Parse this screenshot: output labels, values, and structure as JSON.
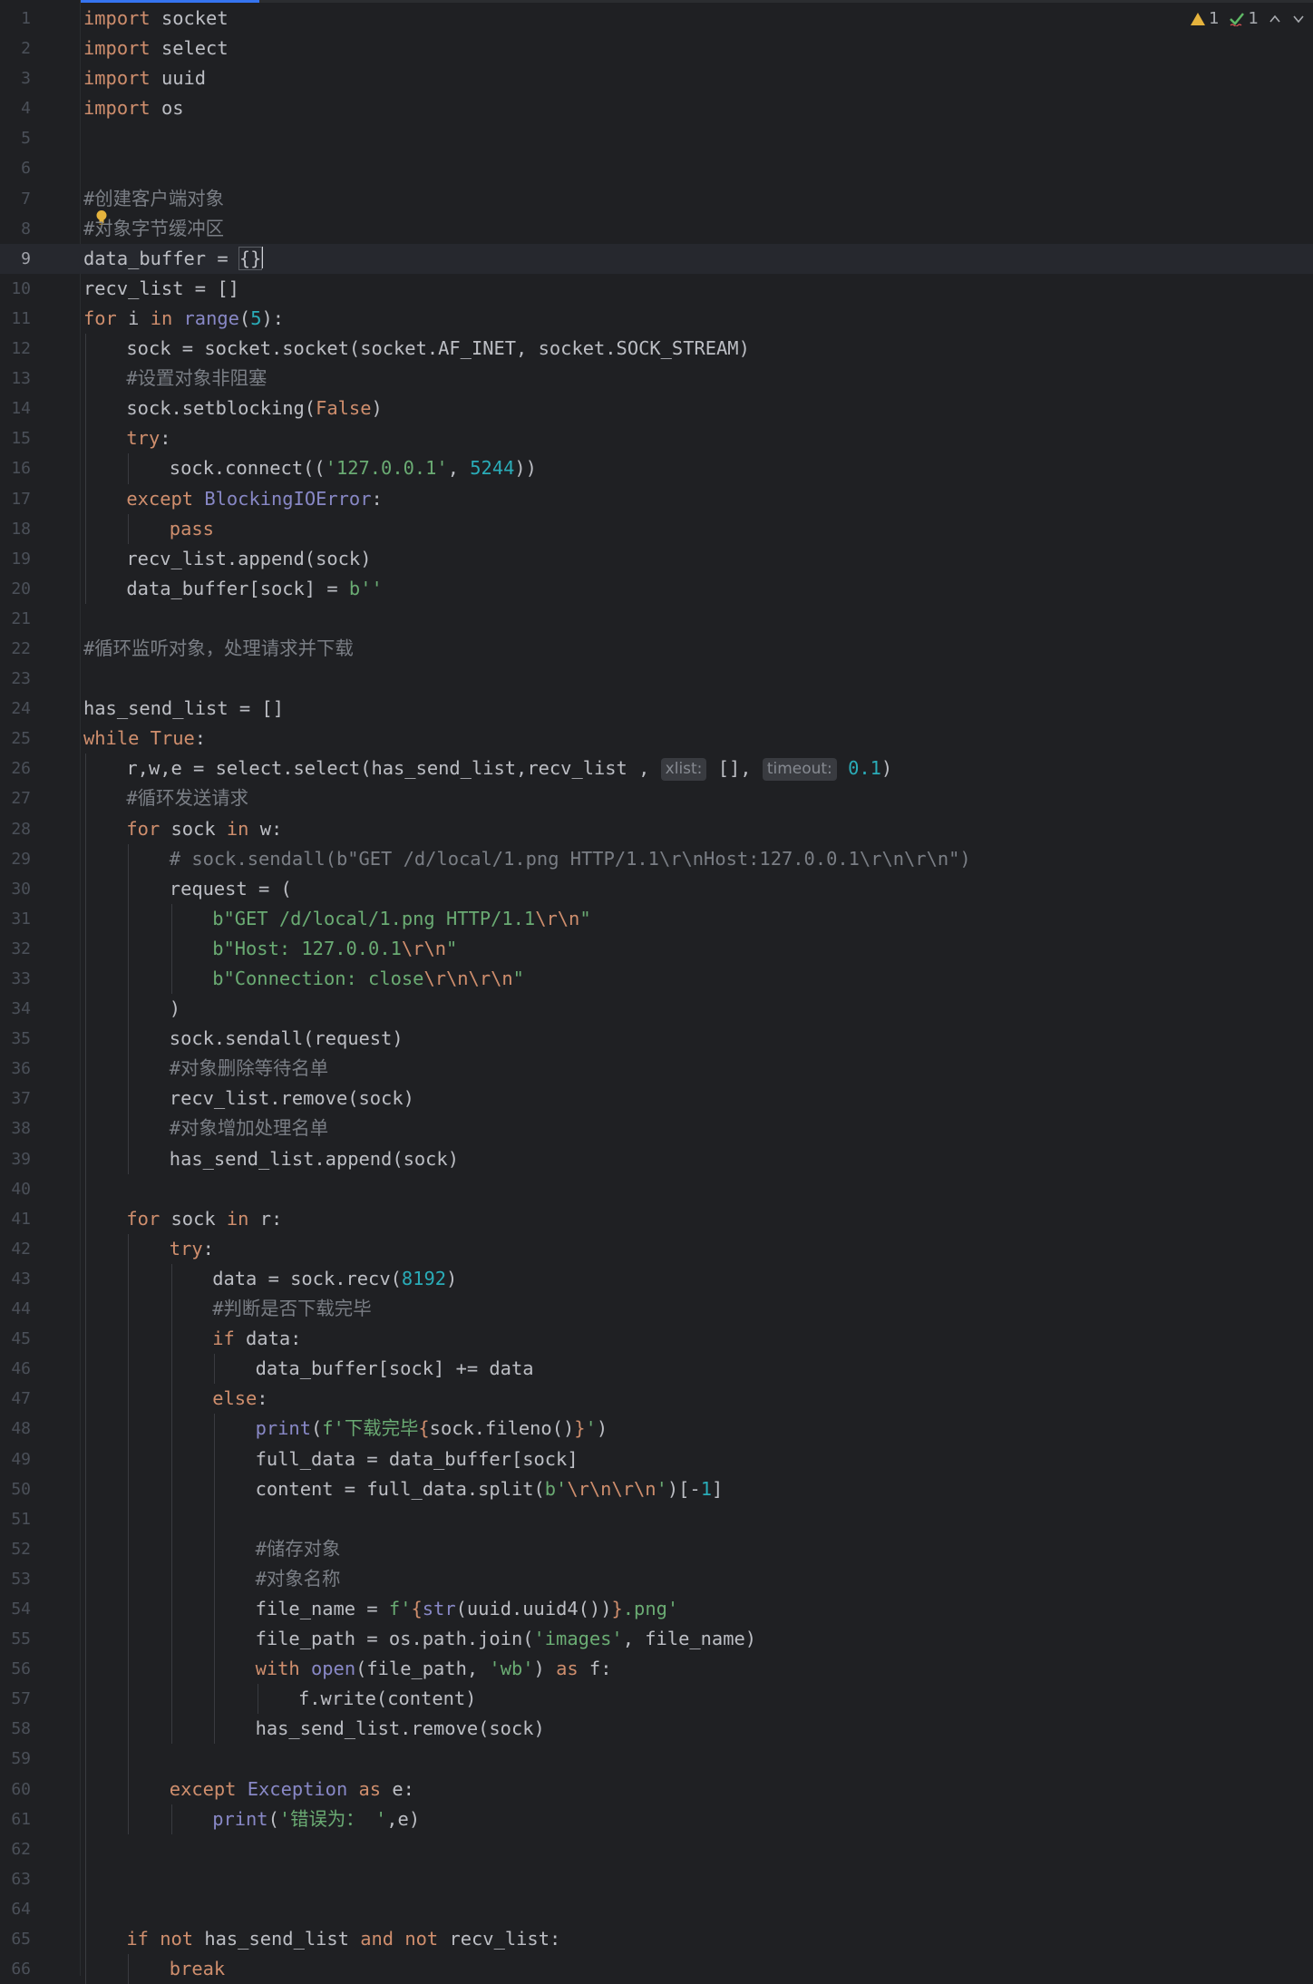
{
  "inspection": {
    "warnings_count": "1",
    "ok_count": "1",
    "up_arrow": "^",
    "down_arrow": "v"
  },
  "current_line": 9,
  "lines": [
    {
      "n": "1"
    },
    {
      "n": "2"
    },
    {
      "n": "3"
    },
    {
      "n": "4"
    },
    {
      "n": "5"
    },
    {
      "n": "6"
    },
    {
      "n": "7"
    },
    {
      "n": "8"
    },
    {
      "n": "9"
    },
    {
      "n": "10"
    },
    {
      "n": "11"
    },
    {
      "n": "12"
    },
    {
      "n": "13"
    },
    {
      "n": "14"
    },
    {
      "n": "15"
    },
    {
      "n": "16"
    },
    {
      "n": "17"
    },
    {
      "n": "18"
    },
    {
      "n": "19"
    },
    {
      "n": "20"
    },
    {
      "n": "21"
    },
    {
      "n": "22"
    },
    {
      "n": "23"
    },
    {
      "n": "24"
    },
    {
      "n": "25"
    },
    {
      "n": "26"
    },
    {
      "n": "27"
    },
    {
      "n": "28"
    },
    {
      "n": "29"
    },
    {
      "n": "30"
    },
    {
      "n": "31"
    },
    {
      "n": "32"
    },
    {
      "n": "33"
    },
    {
      "n": "34"
    },
    {
      "n": "35"
    },
    {
      "n": "36"
    },
    {
      "n": "37"
    },
    {
      "n": "38"
    },
    {
      "n": "39"
    },
    {
      "n": "40"
    },
    {
      "n": "41"
    },
    {
      "n": "42"
    },
    {
      "n": "43"
    },
    {
      "n": "44"
    },
    {
      "n": "45"
    },
    {
      "n": "46"
    },
    {
      "n": "47"
    },
    {
      "n": "48"
    },
    {
      "n": "49"
    },
    {
      "n": "50"
    },
    {
      "n": "51"
    },
    {
      "n": "52"
    },
    {
      "n": "53"
    },
    {
      "n": "54"
    },
    {
      "n": "55"
    },
    {
      "n": "56"
    },
    {
      "n": "57"
    },
    {
      "n": "58"
    },
    {
      "n": "59"
    },
    {
      "n": "60"
    },
    {
      "n": "61"
    },
    {
      "n": "62"
    },
    {
      "n": "63"
    },
    {
      "n": "64"
    },
    {
      "n": "65"
    },
    {
      "n": "66"
    }
  ],
  "code": {
    "l1": [
      "import",
      " socket"
    ],
    "l2": [
      "import",
      " select"
    ],
    "l3": [
      "import",
      " uuid"
    ],
    "l4": [
      "import",
      " os"
    ],
    "l7": "#创建客户端对象",
    "l8": "#对象字节缓冲区",
    "l9": [
      "data_buffer = ",
      "{}"
    ],
    "l10": "recv_list = []",
    "l11": [
      "for",
      " i ",
      "in",
      " ",
      "range",
      "(",
      "5",
      "):"
    ],
    "l12": "sock = socket.socket(socket.AF_INET, socket.SOCK_STREAM)",
    "l13": "#设置对象非阻塞",
    "l14": [
      "sock.setblocking(",
      "False",
      ")"
    ],
    "l15": [
      "try",
      ":"
    ],
    "l16": [
      "sock.connect((",
      "'127.0.0.1'",
      ", ",
      "5244",
      "))"
    ],
    "l17": [
      "except",
      " ",
      "BlockingIOError",
      ":"
    ],
    "l18": "pass",
    "l19": "recv_list.append(sock)",
    "l20": [
      "data_buffer[sock] = ",
      "b''"
    ],
    "l22": "#循环监听对象，处理请求并下载",
    "l24": "has_send_list = []",
    "l25": [
      "while",
      " ",
      "True",
      ":"
    ],
    "l26": [
      "r,w,e = select.select(has_send_list,recv_list , ",
      "xlist:",
      " [], ",
      "timeout:",
      " ",
      "0.1",
      ")"
    ],
    "l27": "#循环发送请求",
    "l28": [
      "for",
      " sock ",
      "in",
      " w:"
    ],
    "l29": "# sock.sendall(b\"GET /d/local/1.png HTTP/1.1\\r\\nHost:127.0.0.1\\r\\n\\r\\n\")",
    "l30": "request = (",
    "l31": [
      "b\"GET /d/local/1.png HTTP/1.1",
      "\\r\\n",
      "\""
    ],
    "l32": [
      "b\"Host: 127.0.0.1",
      "\\r\\n",
      "\""
    ],
    "l33": [
      "b\"Connection: close",
      "\\r\\n\\r\\n",
      "\""
    ],
    "l34": ")",
    "l35": "sock.sendall(request)",
    "l36": "#对象删除等待名单",
    "l37": "recv_list.remove(sock)",
    "l38": "#对象增加处理名单",
    "l39": "has_send_list.append(sock)",
    "l41": [
      "for",
      " sock ",
      "in",
      " r:"
    ],
    "l42": [
      "try",
      ":"
    ],
    "l43": [
      "data = sock.recv(",
      "8192",
      ")"
    ],
    "l44": "#判断是否下载完毕",
    "l45": [
      "if",
      " data:"
    ],
    "l46": "data_buffer[sock] += data",
    "l47": [
      "else",
      ":"
    ],
    "l48": [
      "print",
      "(",
      "f'",
      "下载完毕",
      "{",
      "sock.fileno()",
      "}",
      "'",
      ")"
    ],
    "l49": "full_data = data_buffer[sock]",
    "l50": [
      "content = full_data.split(",
      "b'",
      "\\r\\n\\r\\n",
      "'",
      ")[-",
      "1",
      "]"
    ],
    "l52": "#储存对象",
    "l53": "#对象名称",
    "l54": [
      "file_name = ",
      "f'",
      "{",
      "str",
      "(uuid.uuid4())",
      "}",
      ".png'"
    ],
    "l55": [
      "file_path = os.path.join(",
      "'images'",
      ", file_name)"
    ],
    "l56": [
      "with",
      " ",
      "open",
      "(file_path, ",
      "'wb'",
      ") ",
      "as",
      " f:"
    ],
    "l57": "f.write(content)",
    "l58": "has_send_list.remove(sock)",
    "l60": [
      "except",
      " ",
      "Exception",
      " ",
      "as",
      " e:"
    ],
    "l61": [
      "print",
      "(",
      "'错误为： '",
      ",e)"
    ],
    "l65": [
      "if",
      " ",
      "not",
      " has_send_list ",
      "and",
      " ",
      "not",
      " recv_list:"
    ],
    "l66": "break"
  },
  "colors": {
    "background": "#1f2023",
    "keyword": "#cf8e6d",
    "builtin": "#8888c6",
    "number": "#2aacb8",
    "string": "#6aab73",
    "comment": "#7a7e85",
    "accent": "#3574f0",
    "warning": "#e5b33d",
    "ok": "#5fb865"
  },
  "icons": [
    "warning-icon",
    "check-icon",
    "chevron-up-icon",
    "chevron-down-icon",
    "lightbulb-icon"
  ]
}
